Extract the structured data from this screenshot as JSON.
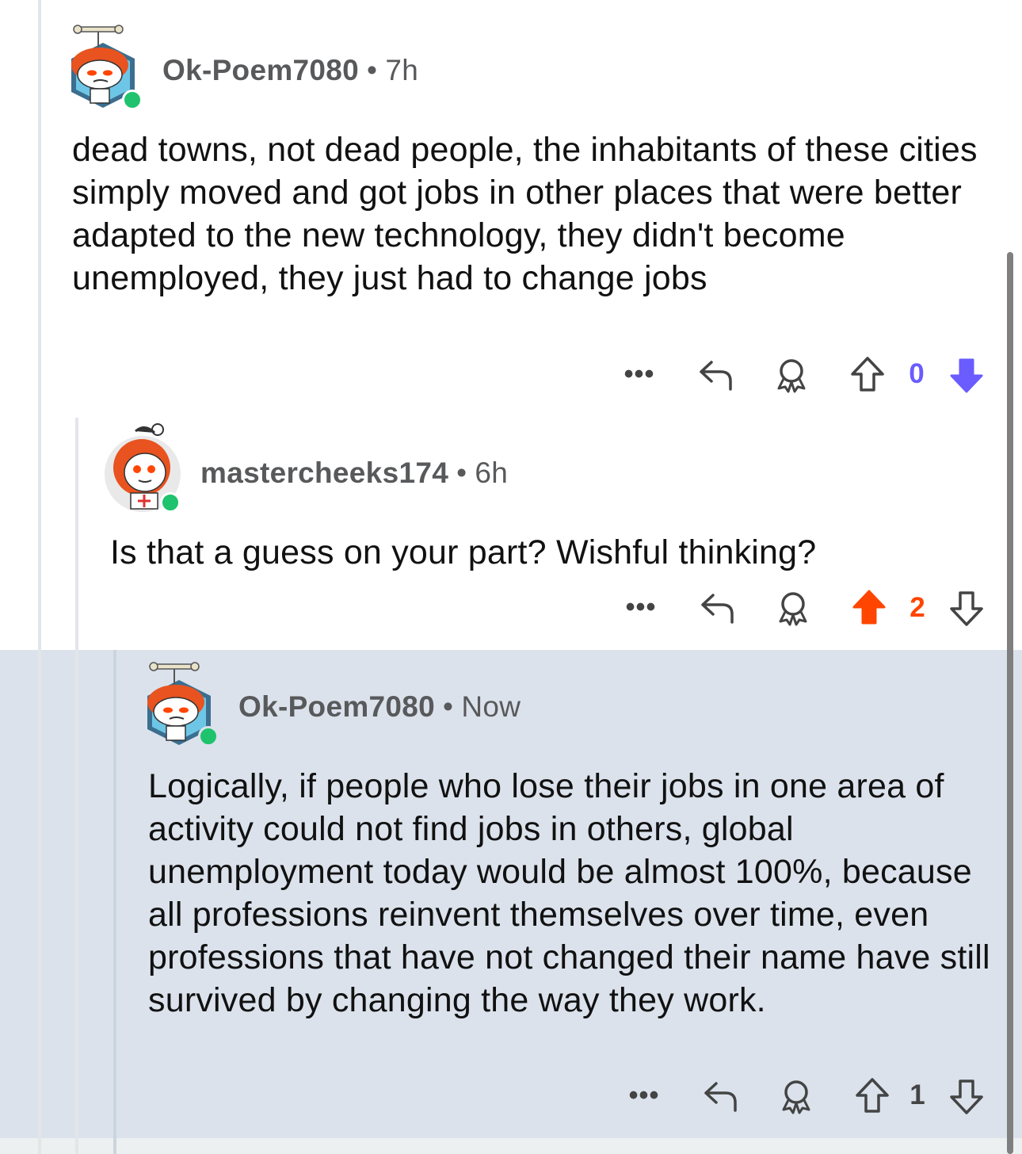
{
  "comments": [
    {
      "username": "Ok-Poem7080",
      "separator": "•",
      "time": "7h",
      "body": "dead towns, not dead people, the inhabitants of these cities simply moved and got jobs in other places that were better adapted to the new technology, they didn't become unemployed, they just had to change jobs",
      "vote_count": "0",
      "vote_state": "downvoted",
      "vote_color": "#6a5cff"
    },
    {
      "username": "mastercheeks174",
      "separator": "•",
      "time": "6h",
      "body": "Is that a guess on your part? Wishful thinking?",
      "vote_count": "2",
      "vote_state": "upvoted",
      "vote_color": "#ff4500"
    },
    {
      "username": "Ok-Poem7080",
      "separator": "•",
      "time": "Now",
      "body": "Logically, if people who lose their jobs in one area of activity could not find jobs in others, global unemployment today would be almost 100%, because all professions reinvent themselves over time, even professions that have not changed their name have still survived by changing the way they work.",
      "vote_count": "1",
      "vote_state": "none",
      "vote_color": "#444444"
    }
  ],
  "actions": {
    "more_label": "•••"
  },
  "icons": [
    "more-icon",
    "reply-icon",
    "award-icon",
    "upvote-icon",
    "downvote-icon"
  ],
  "colors": {
    "online": "#1fc26d",
    "highlight_bg": "#dbe2ec",
    "upvote": "#ff4500",
    "downvote": "#6a5cff"
  }
}
